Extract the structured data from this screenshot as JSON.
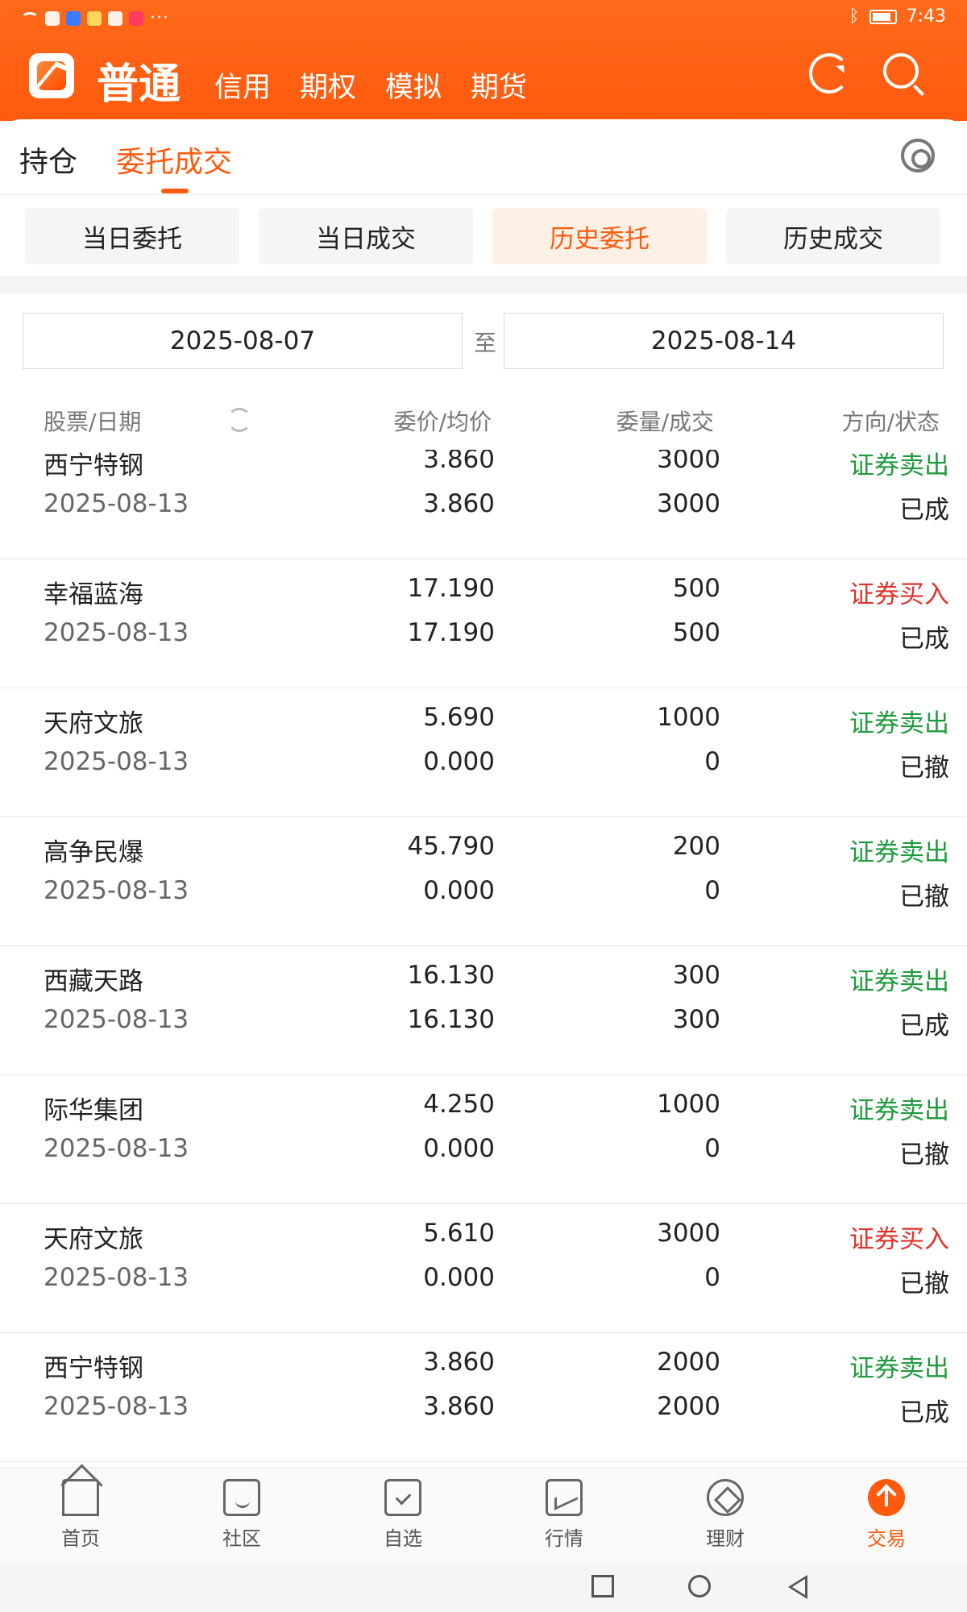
{
  "status_bar": {
    "time": "7:43",
    "icons": [
      "wifi-icon",
      "telegram-icon",
      "mail-icon",
      "weather-icon",
      "shield-icon",
      "app-icon"
    ],
    "more": "···"
  },
  "header": {
    "title": "普通",
    "tabs": [
      "信用",
      "期权",
      "模拟",
      "期货"
    ],
    "icons": [
      "refresh-icon",
      "search-icon"
    ],
    "accent": "#ff5a0e"
  },
  "main_tabs": {
    "items": [
      "持仓",
      "委托成交"
    ],
    "active": 1
  },
  "segments": {
    "items": [
      "当日委托",
      "当日成交",
      "历史委托",
      "历史成交"
    ],
    "active": 2
  },
  "date_range": {
    "start": "2025-08-07",
    "separator": "至",
    "end": "2025-08-14"
  },
  "columns": {
    "c0": "股票/日期",
    "c1": "委价/均价",
    "c2": "委量/成交",
    "c3": "方向/状态"
  },
  "rows": [
    {
      "name": "西宁特钢",
      "date": "2025-08-13",
      "price": "3.860",
      "avg": "3.860",
      "qty": "3000",
      "filled": "3000",
      "dir": "证券卖出",
      "type": "sell",
      "status": "已成"
    },
    {
      "name": "幸福蓝海",
      "date": "2025-08-13",
      "price": "17.190",
      "avg": "17.190",
      "qty": "500",
      "filled": "500",
      "dir": "证券买入",
      "type": "buy",
      "status": "已成"
    },
    {
      "name": "天府文旅",
      "date": "2025-08-13",
      "price": "5.690",
      "avg": "0.000",
      "qty": "1000",
      "filled": "0",
      "dir": "证券卖出",
      "type": "sell",
      "status": "已撤"
    },
    {
      "name": "高争民爆",
      "date": "2025-08-13",
      "price": "45.790",
      "avg": "0.000",
      "qty": "200",
      "filled": "0",
      "dir": "证券卖出",
      "type": "sell",
      "status": "已撤"
    },
    {
      "name": "西藏天路",
      "date": "2025-08-13",
      "price": "16.130",
      "avg": "16.130",
      "qty": "300",
      "filled": "300",
      "dir": "证券卖出",
      "type": "sell",
      "status": "已成"
    },
    {
      "name": "际华集团",
      "date": "2025-08-13",
      "price": "4.250",
      "avg": "0.000",
      "qty": "1000",
      "filled": "0",
      "dir": "证券卖出",
      "type": "sell",
      "status": "已撤"
    },
    {
      "name": "天府文旅",
      "date": "2025-08-13",
      "price": "5.610",
      "avg": "0.000",
      "qty": "3000",
      "filled": "0",
      "dir": "证券买入",
      "type": "buy",
      "status": "已撤"
    },
    {
      "name": "西宁特钢",
      "date": "2025-08-13",
      "price": "3.860",
      "avg": "3.860",
      "qty": "2000",
      "filled": "2000",
      "dir": "证券卖出",
      "type": "sell",
      "status": "已成"
    }
  ],
  "bottom_nav": {
    "items": [
      "首页",
      "社区",
      "自选",
      "行情",
      "理财",
      "交易"
    ],
    "active": 5
  },
  "colors": {
    "sell": "#1e9b3c",
    "buy": "#e0332b"
  }
}
